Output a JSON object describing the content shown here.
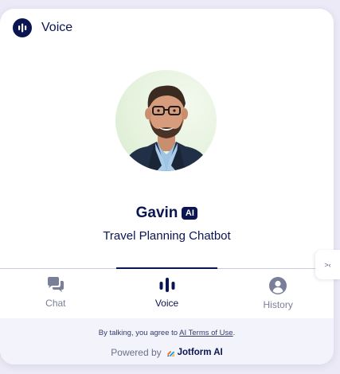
{
  "header": {
    "title": "Voice",
    "icon": "voice-bars-icon"
  },
  "agent": {
    "name": "Gavin",
    "badge": "AI",
    "subtitle": "Travel Planning Chatbot",
    "avatar": "agent-photo"
  },
  "tabs": [
    {
      "label": "Chat",
      "icon": "chat-bubbles-icon",
      "active": false
    },
    {
      "label": "Voice",
      "icon": "voice-bars-icon",
      "active": true
    },
    {
      "label": "History",
      "icon": "user-circle-icon",
      "active": false
    }
  ],
  "footer": {
    "terms_prefix": "By talking, you agree to ",
    "terms_link": "AI Terms of Use",
    "terms_suffix": ".",
    "powered_by": "Powered by",
    "brand": "Jotform AI"
  },
  "side_toggle": {
    "label": ">‹",
    "icon": "collapse-arrows-icon"
  },
  "colors": {
    "navy": "#0a1551",
    "muted": "#7a7f99",
    "footer_bg": "#f3f3fb",
    "page_bg": "#eceaf6"
  }
}
